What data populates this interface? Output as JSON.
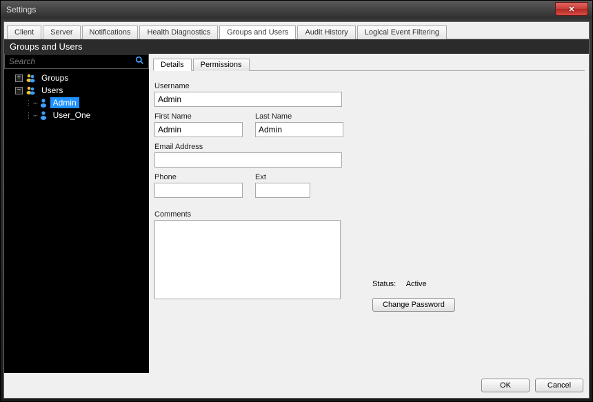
{
  "window": {
    "title": "Settings"
  },
  "tabs": [
    "Client",
    "Server",
    "Notifications",
    "Health Diagnostics",
    "Groups and Users",
    "Audit History",
    "Logical Event Filtering"
  ],
  "active_tab": "Groups and Users",
  "panel_title": "Groups and Users",
  "search": {
    "placeholder": "Search"
  },
  "tree": {
    "groups_label": "Groups",
    "users_label": "Users",
    "users": [
      "Admin",
      "User_One"
    ],
    "selected": "Admin"
  },
  "subtabs": [
    "Details",
    "Permissions"
  ],
  "active_subtab": "Details",
  "form": {
    "username_label": "Username",
    "username": "Admin",
    "firstname_label": "First Name",
    "firstname": "Admin",
    "lastname_label": "Last Name",
    "lastname": "Admin",
    "email_label": "Email Address",
    "email": "",
    "phone_label": "Phone",
    "phone": "",
    "ext_label": "Ext",
    "ext": "",
    "comments_label": "Comments",
    "comments": ""
  },
  "status": {
    "label": "Status:",
    "value": "Active"
  },
  "buttons": {
    "change_password": "Change Password",
    "ok": "OK",
    "cancel": "Cancel"
  }
}
